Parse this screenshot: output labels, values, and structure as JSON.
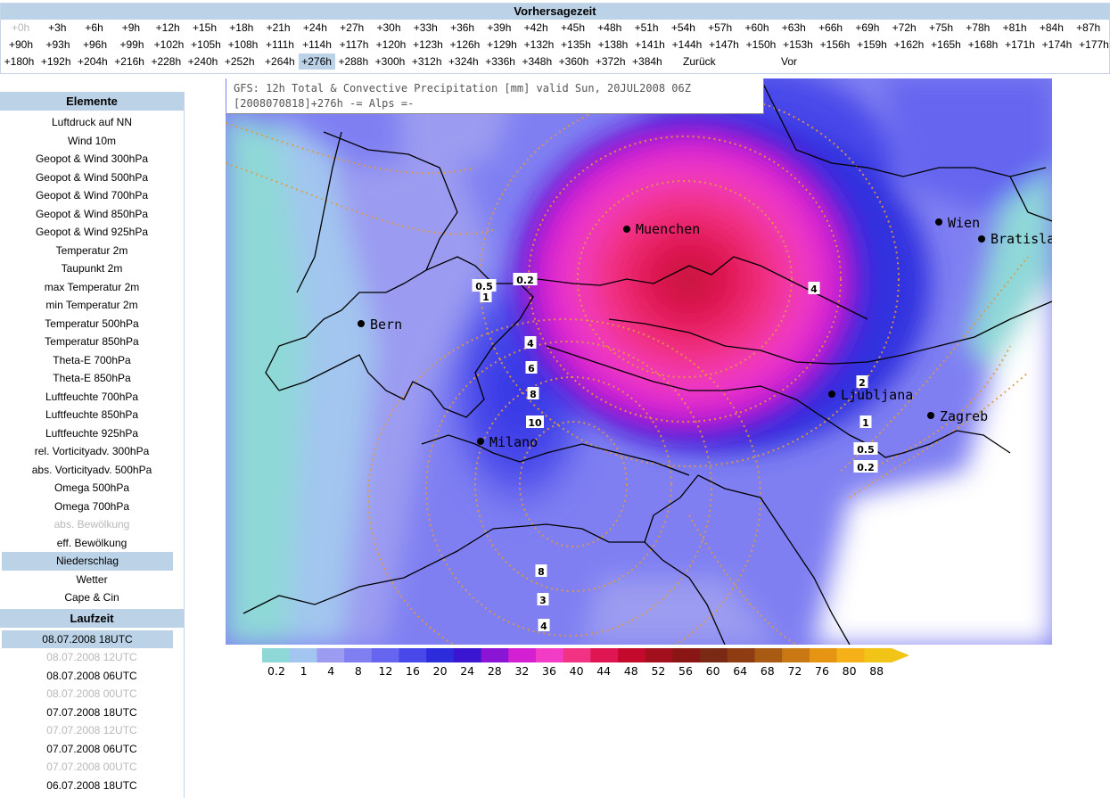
{
  "top_bar": {
    "title": "Vorhersagezeit",
    "rows": [
      [
        "+0h",
        "+3h",
        "+6h",
        "+9h",
        "+12h",
        "+15h",
        "+18h",
        "+21h",
        "+24h",
        "+27h",
        "+30h",
        "+33h",
        "+36h",
        "+39h",
        "+42h",
        "+45h",
        "+48h",
        "+51h",
        "+54h",
        "+57h",
        "+60h",
        "+63h",
        "+66h",
        "+69h",
        "+72h",
        "+75h",
        "+78h",
        "+81h",
        "+84h",
        "+87h"
      ],
      [
        "+90h",
        "+93h",
        "+96h",
        "+99h",
        "+102h",
        "+105h",
        "+108h",
        "+111h",
        "+114h",
        "+117h",
        "+120h",
        "+123h",
        "+126h",
        "+129h",
        "+132h",
        "+135h",
        "+138h",
        "+141h",
        "+144h",
        "+147h",
        "+150h",
        "+153h",
        "+156h",
        "+159h",
        "+162h",
        "+165h",
        "+168h",
        "+171h",
        "+174h",
        "+177h"
      ],
      [
        "+180h",
        "+192h",
        "+204h",
        "+216h",
        "+228h",
        "+240h",
        "+252h",
        "+264h",
        "+276h",
        "+288h",
        "+300h",
        "+312h",
        "+324h",
        "+336h",
        "+348h",
        "+360h",
        "+372h",
        "+384h"
      ]
    ],
    "disabled": [
      "+0h"
    ],
    "selected": "+276h",
    "back_label": "Zurück",
    "forward_label": "Vor"
  },
  "sidebar": {
    "elements_header": "Elemente",
    "elements": [
      {
        "label": "Luftdruck auf NN"
      },
      {
        "label": "Wind 10m"
      },
      {
        "label": "Geopot & Wind 300hPa"
      },
      {
        "label": "Geopot & Wind 500hPa"
      },
      {
        "label": "Geopot & Wind 700hPa"
      },
      {
        "label": "Geopot & Wind 850hPa"
      },
      {
        "label": "Geopot & Wind 925hPa"
      },
      {
        "label": "Temperatur 2m"
      },
      {
        "label": "Taupunkt 2m"
      },
      {
        "label": "max Temperatur 2m"
      },
      {
        "label": "min Temperatur 2m"
      },
      {
        "label": "Temperatur 500hPa"
      },
      {
        "label": "Temperatur 850hPa"
      },
      {
        "label": "Theta-E 700hPa"
      },
      {
        "label": "Theta-E 850hPa"
      },
      {
        "label": "Luftfeuchte 700hPa"
      },
      {
        "label": "Luftfeuchte 850hPa"
      },
      {
        "label": "Luftfeuchte 925hPa"
      },
      {
        "label": "rel. Vorticityadv. 300hPa"
      },
      {
        "label": "abs. Vorticityadv. 500hPa"
      },
      {
        "label": "Omega 500hPa"
      },
      {
        "label": "Omega 700hPa"
      },
      {
        "label": "abs. Bewölkung",
        "disabled": true
      },
      {
        "label": "eff. Bewölkung"
      },
      {
        "label": "Niederschlag",
        "selected": true
      },
      {
        "label": "Wetter"
      },
      {
        "label": "Cape & Cin"
      }
    ],
    "runs_header": "Laufzeit",
    "runs": [
      {
        "label": "08.07.2008 18UTC",
        "selected": true
      },
      {
        "label": "08.07.2008 12UTC",
        "disabled": true
      },
      {
        "label": "08.07.2008 06UTC"
      },
      {
        "label": "08.07.2008 00UTC",
        "disabled": true
      },
      {
        "label": "07.07.2008 18UTC"
      },
      {
        "label": "07.07.2008 12UTC",
        "disabled": true
      },
      {
        "label": "07.07.2008 06UTC"
      },
      {
        "label": "07.07.2008 00UTC",
        "disabled": true
      },
      {
        "label": "06.07.2008 18UTC"
      }
    ]
  },
  "map": {
    "title_line1": "GFS: 12h Total & Convective Precipitation [mm] valid Sun, 20JUL2008 06Z",
    "title_line2": "[2008070818]+276h -= Alps =-",
    "cities": [
      {
        "name": "Muenchen"
      },
      {
        "name": "Wien"
      },
      {
        "name": "Bratisla"
      },
      {
        "name": "Bern"
      },
      {
        "name": "Ljubljana"
      },
      {
        "name": "Zagreb"
      },
      {
        "name": "Milano"
      }
    ],
    "contour_labels": [
      "0.5",
      "0.2",
      "1",
      "4",
      "4",
      "6",
      "8",
      "10",
      "2",
      "1",
      "0.5",
      "0.2",
      "8",
      "3",
      "4"
    ]
  },
  "color_scale": {
    "ticks": [
      "0.2",
      "1",
      "4",
      "8",
      "12",
      "16",
      "20",
      "24",
      "28",
      "32",
      "36",
      "40",
      "44",
      "48",
      "52",
      "56",
      "60",
      "64",
      "68",
      "72",
      "76",
      "80",
      "88"
    ],
    "colors": [
      "#8fd8d8",
      "#a2c6ef",
      "#9b9bf1",
      "#7f7ff2",
      "#6565f0",
      "#4848ea",
      "#2c2cdd",
      "#3a16d2",
      "#8b15d4",
      "#d41fd2",
      "#f23cc5",
      "#f23283",
      "#e01652",
      "#c30a2d",
      "#a2101e",
      "#8a1515",
      "#7a2a14",
      "#8f3c12",
      "#a95a13",
      "#c97813",
      "#e69513",
      "#f5b117",
      "#f3c418"
    ]
  }
}
